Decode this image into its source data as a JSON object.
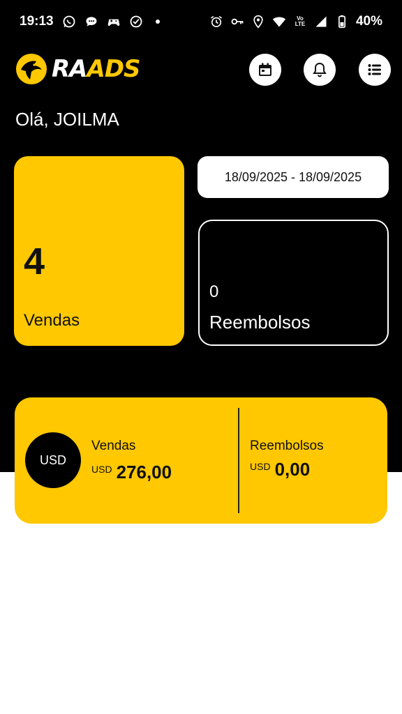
{
  "status_bar": {
    "time": "19:13",
    "battery": "40%",
    "left_icons": [
      "whatsapp-icon",
      "chat-icon",
      "gamepad-icon",
      "check-circle-icon"
    ],
    "right_icons": [
      "alarm-icon",
      "key-icon",
      "location-icon",
      "wifi-icon",
      "volte-icon",
      "signal-icon",
      "battery-icon"
    ],
    "volte_top": "Vo",
    "volte_bottom": "LTE"
  },
  "header": {
    "logo_ra": "RA",
    "logo_ads": "ADS",
    "buttons": [
      "calendar-icon",
      "bell-icon",
      "menu-list-icon"
    ]
  },
  "greeting": "Olá, JOILMA",
  "date_range": "18/09/2025 - 18/09/2025",
  "cards": {
    "sales_count": "4",
    "sales_label": "Vendas",
    "refunds_count": "0",
    "refunds_label": "Reembolsos"
  },
  "summary": {
    "currency_badge": "USD",
    "sales_title": "Vendas",
    "sales_currency": "USD",
    "sales_amount": "276,00",
    "refunds_title": "Reembolsos",
    "refunds_currency": "USD",
    "refunds_amount": "0,00"
  },
  "colors": {
    "accent": "#ffc800",
    "background_top": "#000000",
    "background_bottom": "#ffffff"
  }
}
